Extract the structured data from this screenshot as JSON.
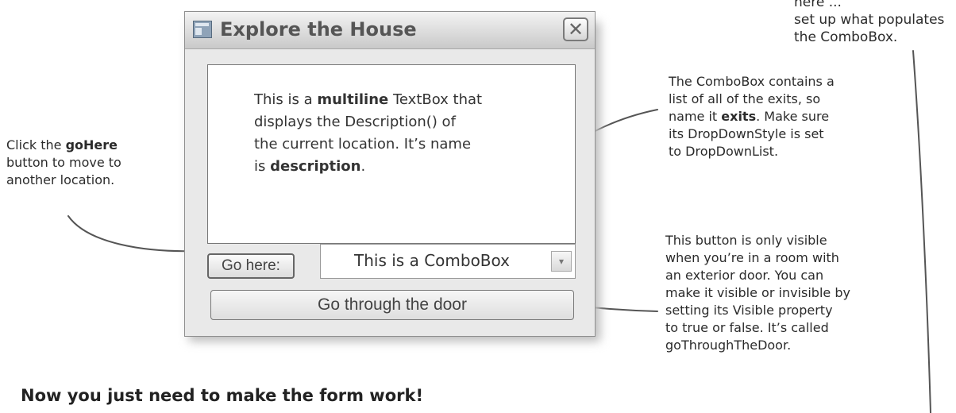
{
  "window": {
    "title": "Explore the House",
    "close_glyph": "✕",
    "textbox": {
      "line1_pre": "This is a ",
      "line1_bold": "multiline",
      "line1_post": " TextBox that",
      "line2": "displays the Description() of",
      "line3": "the current location. It’s name",
      "line4_pre": "is ",
      "line4_bold": "description",
      "line4_post": "."
    },
    "go_here_label": "Go here:",
    "combo_label": "This is a ComboBox",
    "combo_arrow_glyph": "▾",
    "door_button_label": "Go through the door"
  },
  "annotations": {
    "left_pre": "Click the ",
    "left_bold": "goHere",
    "left_post": "\nbutton to move to\nanother location.",
    "top_right": "here ...\nset up what populates\nthe ComboBox.",
    "combo_note_a": "The ComboBox contains a\nlist of all of the exits, so\nname it ",
    "combo_note_bold": "exits",
    "combo_note_b": ". Make sure\nits DropDownStyle is set\nto DropDownList.",
    "door_note": "This button is only visible\nwhen you’re in a room with\nan exterior door. You can\nmake it visible or invisible by\nsetting its Visible property\nto true or false. It’s called\ngoThroughTheDoor."
  },
  "footer_text": "Now you just need to make the form work!"
}
